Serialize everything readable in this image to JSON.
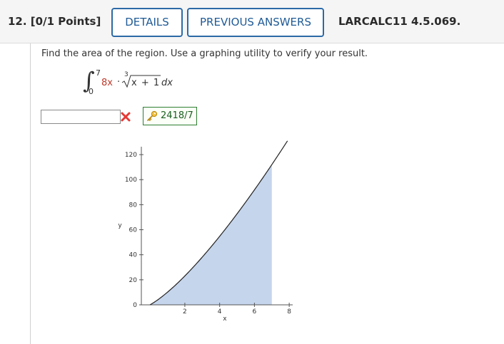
{
  "header": {
    "question_label": "12. [0/1 Points]",
    "details_label": "DETAILS",
    "previous_answers_label": "PREVIOUS ANSWERS",
    "reference": "LARCALC11 4.5.069."
  },
  "question": {
    "prompt": "Find the area of the region. Use a graphing utility to verify your result.",
    "integral": {
      "lower": "0",
      "upper": "7",
      "coefficient": "8x",
      "dot": "·",
      "root_index": "3",
      "radicand": "x + 1",
      "differential": "dx"
    }
  },
  "answer": {
    "input_value": "",
    "status_icon": "wrong-x-icon",
    "key_icon": "key-icon",
    "correct_answer": "2418/7"
  },
  "colors": {
    "accent": "#2c6aa6",
    "wrong": "#e53935",
    "correct_border": "#2e7d32",
    "fill": "#c5d5ec"
  },
  "chart_data": {
    "type": "area",
    "function": "8x * cbrt(x + 1)",
    "x": [
      0,
      1,
      2,
      3,
      4,
      5,
      6,
      7
    ],
    "y": [
      0,
      10.08,
      23.08,
      38.1,
      54.72,
      72.68,
      91.81,
      112
    ],
    "shade_from": 0,
    "shade_to": 7,
    "xlim": [
      -0.5,
      8.2
    ],
    "ylim": [
      0,
      132
    ],
    "x_ticks": [
      "2",
      "4",
      "6",
      "8"
    ],
    "y_ticks": [
      "0",
      "20",
      "40",
      "60",
      "80",
      "100",
      "120"
    ],
    "xlabel": "x",
    "ylabel": "y",
    "grid": false
  }
}
